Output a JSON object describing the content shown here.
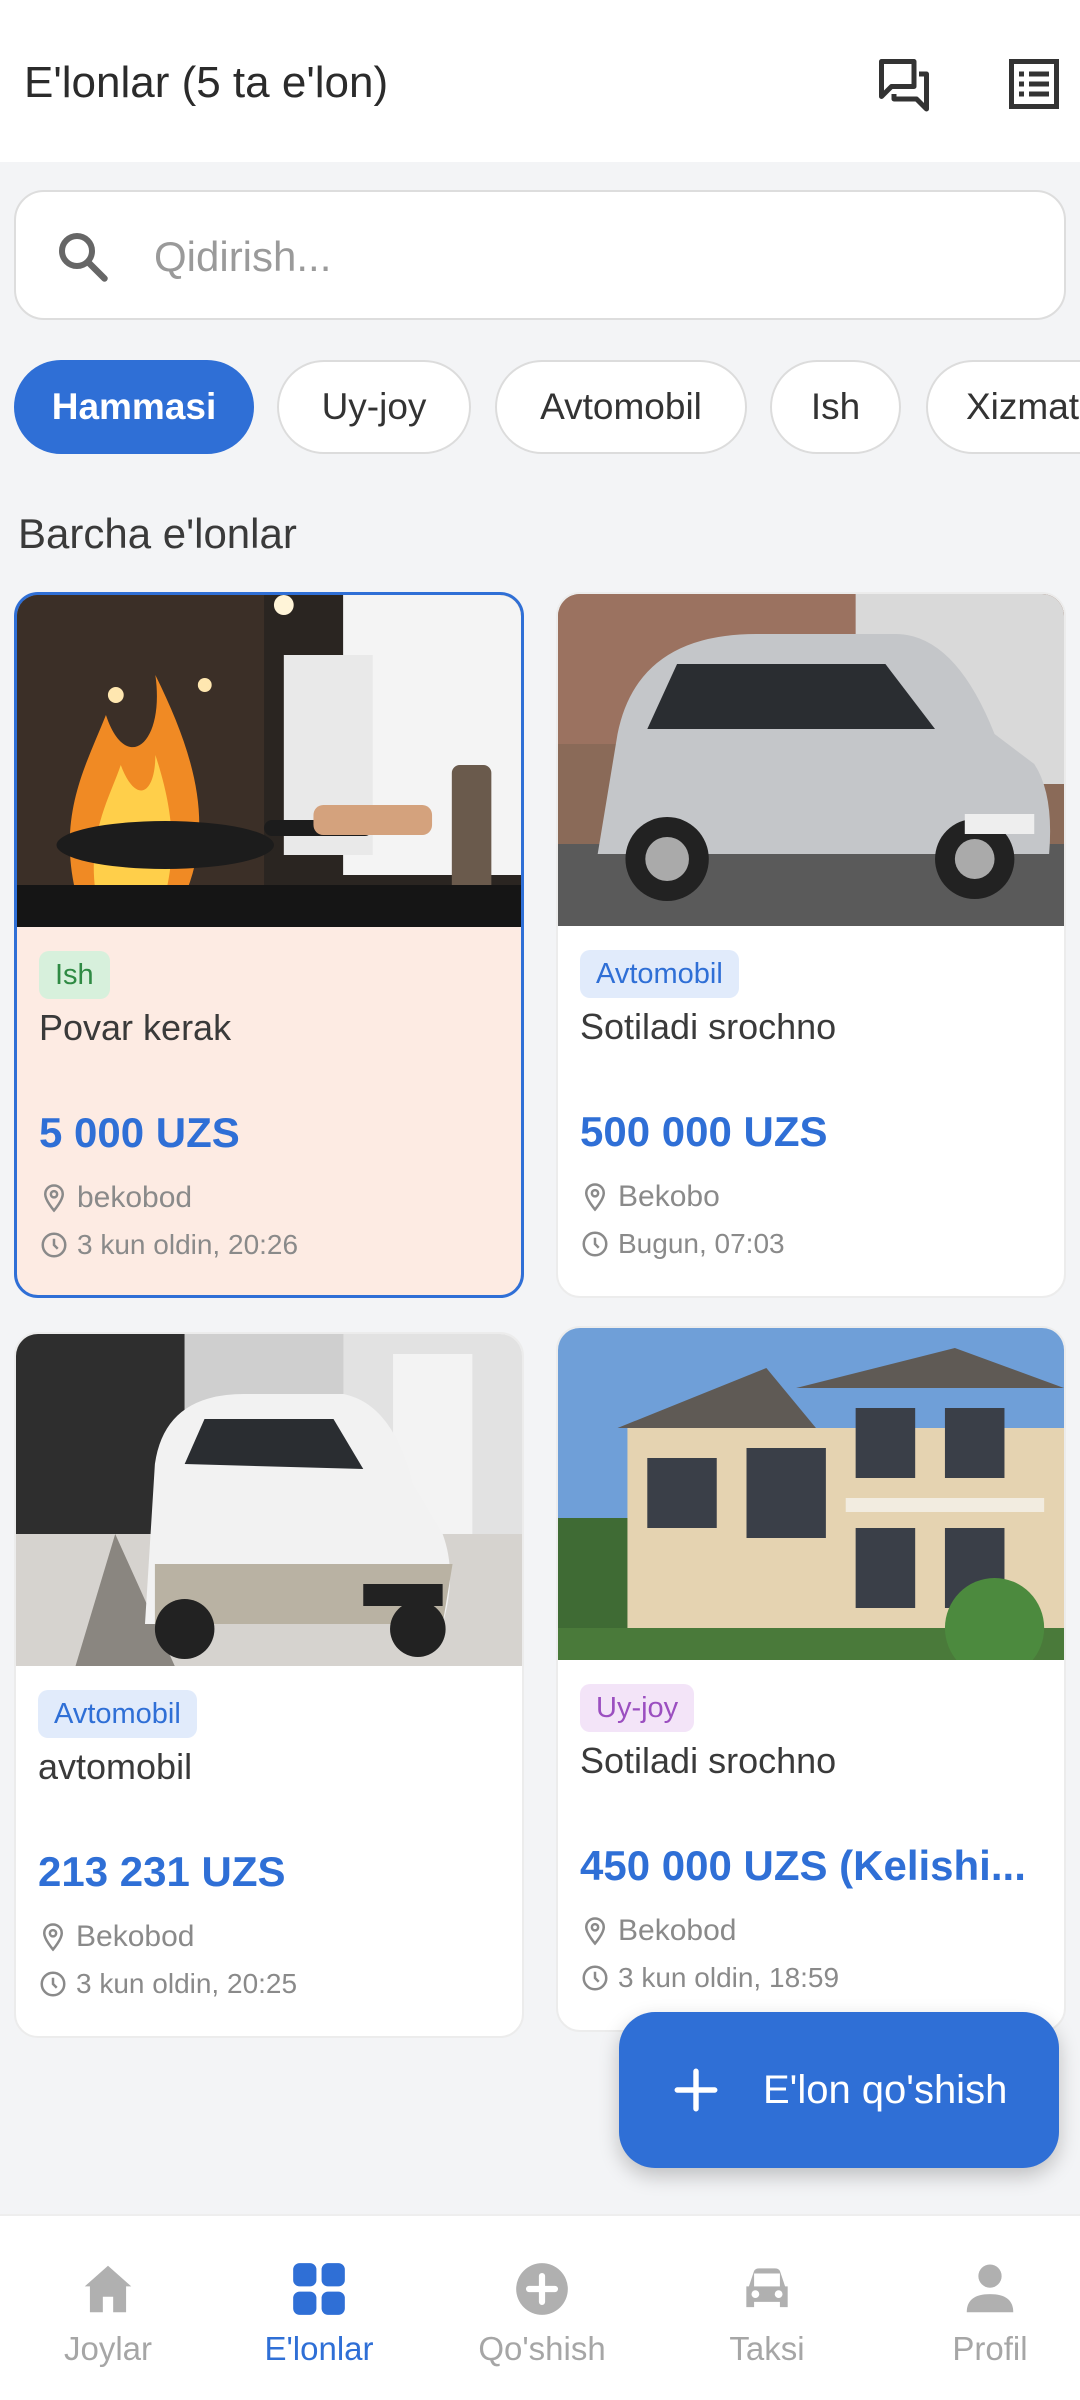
{
  "header": {
    "title": "E'lonlar (5 ta e'lon)"
  },
  "search": {
    "placeholder": "Qidirish..."
  },
  "chips": [
    {
      "label": "Hammasi",
      "active": true
    },
    {
      "label": "Uy-joy"
    },
    {
      "label": "Avtomobil"
    },
    {
      "label": "Ish"
    },
    {
      "label": "Xizmat"
    }
  ],
  "section": {
    "title": "Barcha e'lonlar"
  },
  "listings": [
    {
      "category": "Ish",
      "title": "Povar kerak",
      "price": "5 000 UZS",
      "location": "bekobod",
      "time": "3 kun oldin, 20:26",
      "image": "chef-cooking"
    },
    {
      "category": "Avtomobil",
      "title": "Sotiladi srochno",
      "price": "500 000 UZS",
      "location": "Bekobo",
      "time": "Bugun, 07:03",
      "image": "silver-hatchback"
    },
    {
      "category": "Avtomobil",
      "title": "avtomobil",
      "price": "213 231 UZS",
      "location": "Bekobod",
      "time": "3 kun oldin, 20:25",
      "image": "white-small-car"
    },
    {
      "category": "Uy-joy",
      "title": "Sotiladi srochno",
      "price": "450 000 UZS (Kelishi...",
      "location": "Bekobod",
      "time": "3 kun oldin, 18:59",
      "image": "house"
    }
  ],
  "fab": {
    "label": "E'lon qo'shish"
  },
  "nav": [
    {
      "label": "Joylar",
      "icon": "home-icon"
    },
    {
      "label": "E'lonlar",
      "icon": "grid-icon",
      "active": true
    },
    {
      "label": "Qo'shish",
      "icon": "add-circle-icon"
    },
    {
      "label": "Taksi",
      "icon": "taxi-icon"
    },
    {
      "label": "Profil",
      "icon": "person-icon"
    }
  ],
  "colors": {
    "primary": "#2f6fd6",
    "background": "#f3f4f6",
    "highlight_card": "#fdebe3"
  }
}
